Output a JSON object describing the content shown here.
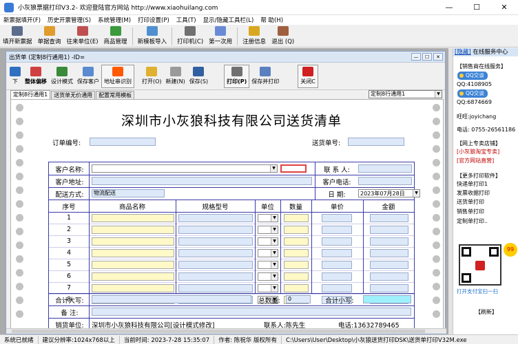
{
  "window": {
    "title": "小灰狼票据打印V3.2- 欢迎登陆官方网站 http://www.xiaohuilang.com",
    "minimize": "—",
    "maximize": "☐",
    "close": "✕"
  },
  "menu": [
    "新票据填开(F)",
    "历史开票管理(S)",
    "系统管理(M)",
    "打印设置(P)",
    "工具(T)",
    "显示/隐藏工具栏(L)",
    "帮 助(H)"
  ],
  "toolbar": [
    {
      "label": "填开新票据",
      "icon": "keyboard-icon",
      "color": "#5b6c8c"
    },
    {
      "label": "单据查询",
      "icon": "magnifier-icon",
      "color": "#e09c2c"
    },
    {
      "label": "往来单位(E)",
      "icon": "contacts-icon",
      "color": "#c05050"
    },
    {
      "label": "商品管理",
      "icon": "product-icon",
      "color": "#3b9a3b"
    },
    {
      "label": "新模板导入",
      "icon": "template-icon",
      "color": "#5090d0"
    },
    {
      "label": "打印机(C)",
      "icon": "printer-icon",
      "color": "#707070"
    },
    {
      "label": "第一次用",
      "icon": "user-icon",
      "color": "#6a8ad6"
    },
    {
      "label": "注册信息",
      "icon": "key-icon",
      "color": "#d8a820"
    },
    {
      "label": "退出 (Q)",
      "icon": "exit-icon",
      "color": "#a06040"
    }
  ],
  "child": {
    "title": "出货单 (定制8行通用1) -ID=",
    "buttons": [
      {
        "label": "下",
        "icon": "arrow-icon",
        "color": "#3070c0"
      },
      {
        "label": "整体偏移",
        "icon": "move-icon",
        "color": "#d04040"
      },
      {
        "label": "设计模式",
        "icon": "design-icon",
        "color": "#3a8a3a"
      },
      {
        "label": "保存客户",
        "icon": "save-customer-icon",
        "color": "#5a8ad0"
      },
      {
        "label": "地址串识别",
        "icon": "taobao-pdd-icon",
        "color": "#ff5a00"
      },
      {
        "label": "打开(O)",
        "icon": "open-folder-icon",
        "color": "#e0b030"
      },
      {
        "label": "新建(N)",
        "icon": "new-document-icon",
        "color": "#9a9a9a"
      },
      {
        "label": "保存(S)",
        "icon": "save-icon",
        "color": "#3060a0"
      },
      {
        "label": "打印(P)",
        "icon": "print-icon",
        "color": "#707070"
      },
      {
        "label": "保存并打印",
        "icon": "save-print-icon",
        "color": "#5a80c0"
      },
      {
        "label": "关闭C",
        "icon": "close-icon",
        "color": "#d02020"
      }
    ],
    "tabs": [
      "定制8行通用1",
      "送货单无价通用",
      "配置常用模板"
    ],
    "template_select": "定制8行通用1"
  },
  "form": {
    "title": "深圳市小灰狼科技有限公司送货清单",
    "order_no_label": "订单编号:",
    "delivery_no_label": "送货单号:",
    "customer_label": "客户名称:",
    "contact_label": "联 系 人:",
    "address_label": "客户地址:",
    "phone_label": "客户电话:",
    "ship_label": "配送方式:",
    "ship_value": "物流配送",
    "date_label": "日    期:",
    "date_value": "2023年07月28日",
    "headers": [
      "序号",
      "商品名称",
      "规格型号",
      "单位",
      "数量",
      "单价",
      "金额"
    ],
    "rows": [
      "1",
      "2",
      "3",
      "4",
      "5",
      "6",
      "7",
      "8"
    ],
    "total_upper_label": "合计大写:",
    "total_qty_label": "总数量:",
    "total_qty_value": "0",
    "subtotal_label": "合计小写:",
    "remark_label": "备    注:",
    "seller_label": "销货单位:",
    "seller_value": "深圳市小灰狼科技有限公司[设计模式修改]",
    "seller_contact": "联系人:陈先生",
    "seller_phone": "电话:13632789465"
  },
  "sidebar": {
    "hide_link": "[隐藏]",
    "header": "在线服务中心",
    "sales_online": "【销售商在线服务】",
    "qq_btn": "QQ交谈",
    "qq1": "QQ:4108905",
    "qq2": "QQ:6874669",
    "wangwang": "旺旺:joyichang",
    "phone": "电话: 0755-26561186",
    "shop_header": "【网上专卖店铺】",
    "shop1": "[小灰狼淘宝专卖]",
    "shop2": "[官方网站直营]",
    "more_header": "【更多打印软件】",
    "soft": [
      "快递单打印1",
      "发票收据打印",
      "送货单打印",
      "销售单打印",
      "定制单打印.."
    ],
    "qr_caption": "打开支付宝扫一扫",
    "refresh": "【刷新】"
  },
  "status": [
    "系统已就绪",
    "建议分辨率:1024x768以上",
    "当前时间: 2023-7-28 15:35:07",
    "作者: 陈祝华 版权所有",
    "C:\\Users\\User\\Desktop\\小灰狼送货打印DSK\\送货单打印V32M.exe"
  ]
}
